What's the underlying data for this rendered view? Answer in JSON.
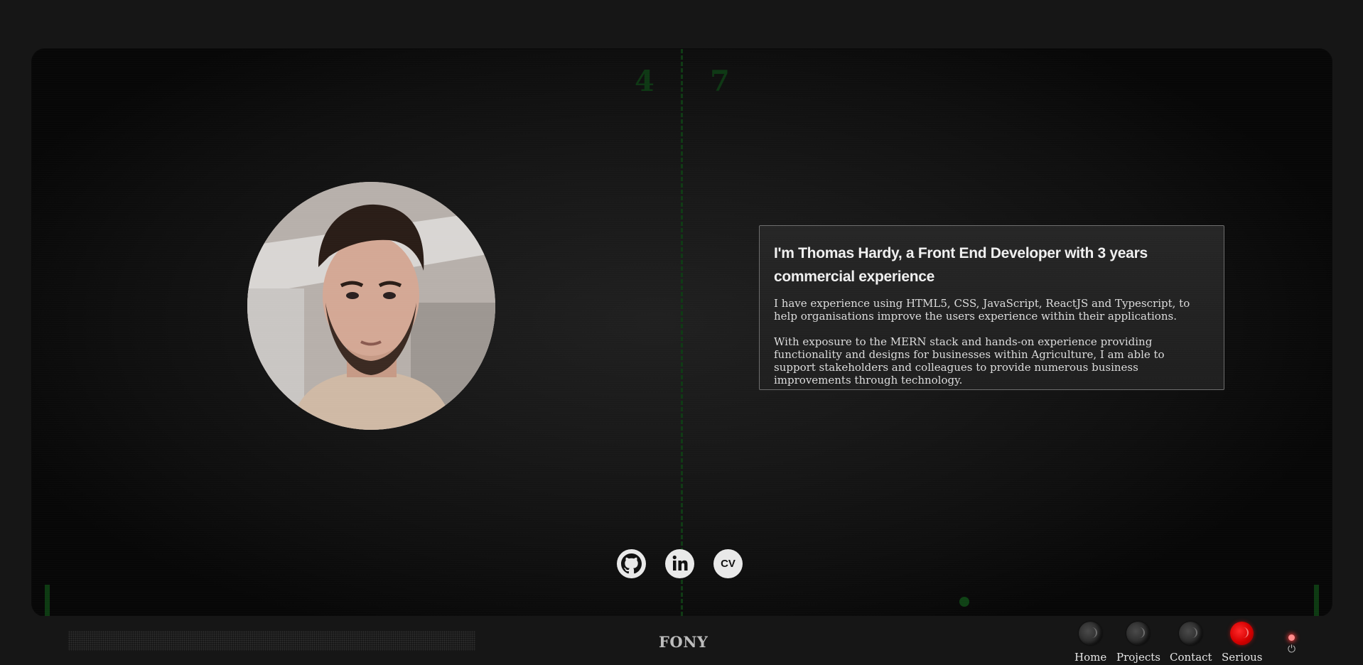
{
  "screen": {
    "score_left": "4",
    "score_right": "7"
  },
  "about": {
    "heading": "I'm Thomas Hardy, a Front End Developer with 3 years commercial experience",
    "paragraph_1": "I have experience using HTML5, CSS, JavaScript, ReactJS and Typescript, to help organisations improve the users experience within their applications.",
    "paragraph_2": "With exposure to the MERN stack and hands-on experience providing functionality and designs for businesses within Agriculture, I am able to support stakeholders and colleagues to provide numerous business improvements through technology."
  },
  "socials": [
    {
      "icon": "github-icon"
    },
    {
      "icon": "linkedin-icon"
    },
    {
      "icon": "cv-icon",
      "label": "CV"
    }
  ],
  "bottom_bar": {
    "brand": "FONY",
    "nav": [
      {
        "label": "Home",
        "active": false
      },
      {
        "label": "Projects",
        "active": false
      },
      {
        "label": "Contact",
        "active": false
      },
      {
        "label": "Serious",
        "active": true
      }
    ],
    "power_icon": "⏻"
  },
  "colors": {
    "accent_green": "#0e3814",
    "active_knob": "#d50000",
    "power_led": "#ff8c8c"
  }
}
